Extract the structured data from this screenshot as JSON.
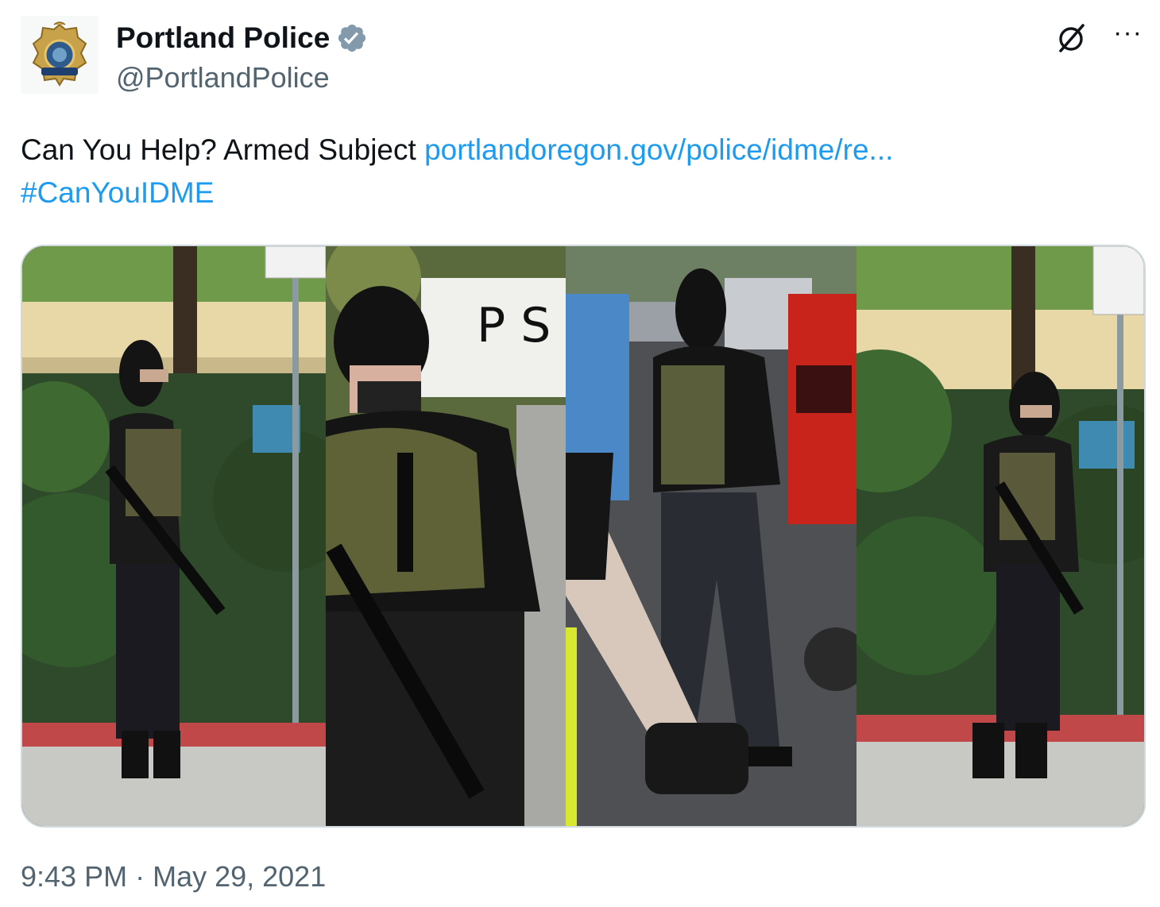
{
  "author": {
    "display_name": "Portland Police",
    "handle": "@PortlandPolice",
    "verified_color": "#829aab",
    "avatar_icon": "police-badge-icon"
  },
  "tweet": {
    "text": "Can You Help? Armed Subject ",
    "link": "portlandoregon.gov/police/idme/re...",
    "hashtag": "#CanYouIDME"
  },
  "media": {
    "photos": [
      {
        "name": "photo-1"
      },
      {
        "name": "photo-2"
      },
      {
        "name": "photo-3"
      },
      {
        "name": "photo-4"
      }
    ]
  },
  "meta": {
    "time": "9:43 PM",
    "separator": " · ",
    "date": "May 29, 2021"
  },
  "colors": {
    "link": "#1d9bf0",
    "secondary_text": "#536471",
    "border": "#cfd9de"
  },
  "icons": [
    "verified-badge-icon",
    "grok-icon",
    "more-icon"
  ]
}
